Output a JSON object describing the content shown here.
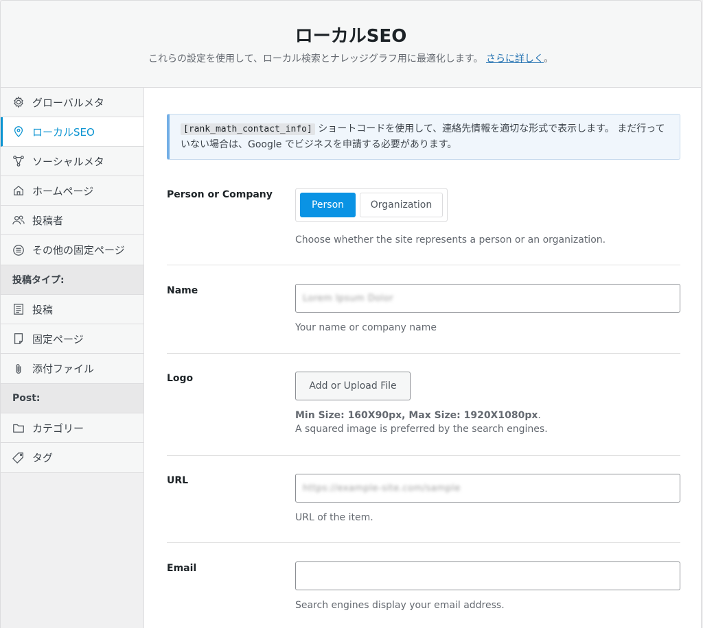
{
  "header": {
    "title": "ローカルSEO",
    "subtitle": "これらの設定を使用して、ローカル検索とナレッジグラフ用に最適化します。",
    "link_text": "さらに詳しく",
    "link_suffix": "。"
  },
  "sidebar": {
    "items": [
      {
        "label": "グローバルメタ",
        "icon": "gear-icon"
      },
      {
        "label": "ローカルSEO",
        "icon": "location-pin-icon",
        "active": true
      },
      {
        "label": "ソーシャルメタ",
        "icon": "share-nodes-icon"
      },
      {
        "label": "ホームページ",
        "icon": "home-icon"
      },
      {
        "label": "投稿者",
        "icon": "users-icon"
      },
      {
        "label": "その他の固定ページ",
        "icon": "list-circle-icon"
      }
    ],
    "post_types_heading": "投稿タイプ:",
    "post_types": [
      {
        "label": "投稿",
        "icon": "document-icon"
      },
      {
        "label": "固定ページ",
        "icon": "page-icon"
      },
      {
        "label": "添付ファイル",
        "icon": "paperclip-icon"
      }
    ],
    "post_heading": "Post:",
    "post_items": [
      {
        "label": "カテゴリー",
        "icon": "folder-icon"
      },
      {
        "label": "タグ",
        "icon": "tag-icon"
      }
    ]
  },
  "notice": {
    "code": "[rank_math_contact_info]",
    "text": " ショートコードを使用して、連絡先情報を適切な形式で表示します。 まだ行っていない場合は、Google でビジネスを申請する必要があります。"
  },
  "form": {
    "person_company": {
      "label": "Person or Company",
      "options": [
        "Person",
        "Organization"
      ],
      "selected": "Person",
      "desc": "Choose whether the site represents a person or an organization."
    },
    "name": {
      "label": "Name",
      "value": "Lorem Ipsum Dolor",
      "desc": "Your name or company name"
    },
    "logo": {
      "label": "Logo",
      "button": "Add or Upload File",
      "size_note": "Min Size: 160X90px, Max Size: 1920X1080px",
      "size_suffix": ".",
      "desc": "A squared image is preferred by the search engines."
    },
    "url": {
      "label": "URL",
      "value": "https://example-site.com/sample",
      "desc": "URL of the item."
    },
    "email": {
      "label": "Email",
      "value": "",
      "desc": "Search engines display your email address."
    }
  }
}
